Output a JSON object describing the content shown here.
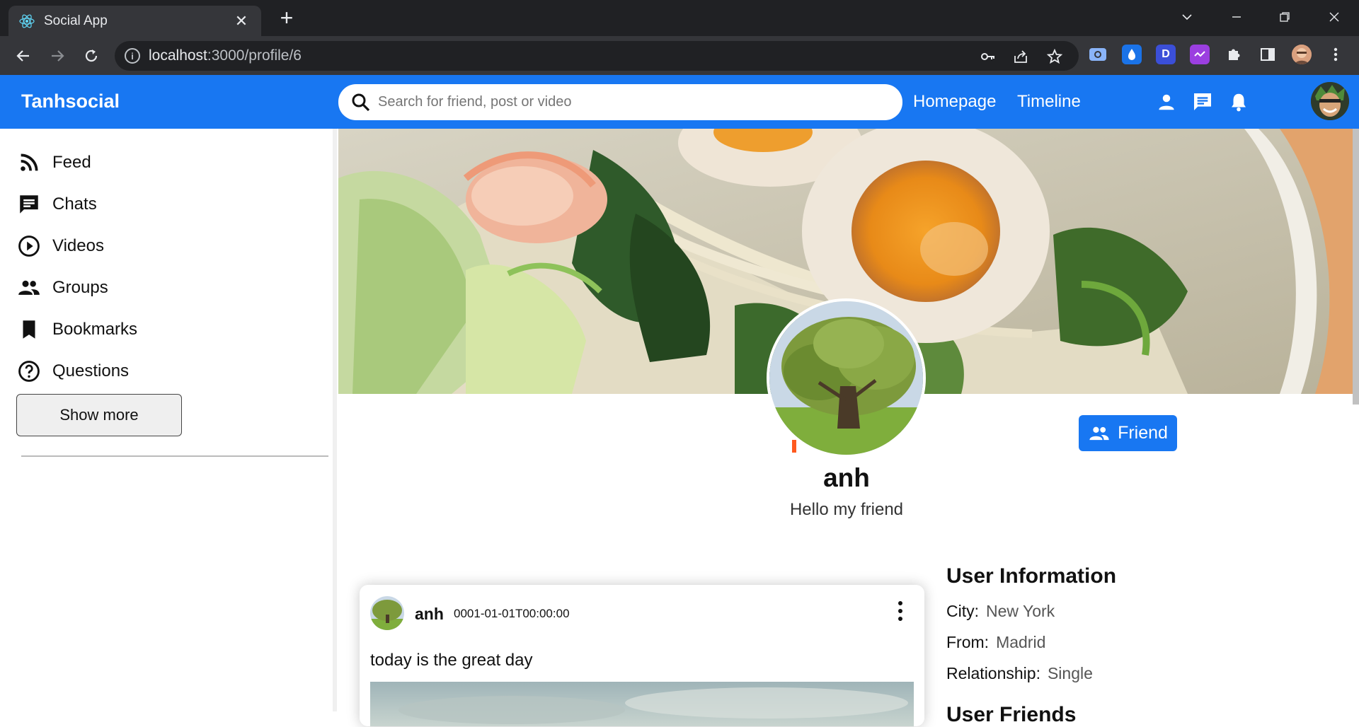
{
  "browser": {
    "tab_title": "Social App",
    "url_host": "localhost",
    "url_path": ":3000/profile/6"
  },
  "app": {
    "logo": "Tanhsocial",
    "search_placeholder": "Search for friend, post or video",
    "nav": {
      "homepage": "Homepage",
      "timeline": "Timeline"
    },
    "accent_color": "#1877f2"
  },
  "sidebar": {
    "items": [
      {
        "label": "Feed",
        "icon": "rss-feed-icon"
      },
      {
        "label": "Chats",
        "icon": "chat-icon"
      },
      {
        "label": "Videos",
        "icon": "play-circle-icon"
      },
      {
        "label": "Groups",
        "icon": "group-icon"
      },
      {
        "label": "Bookmarks",
        "icon": "bookmark-icon"
      },
      {
        "label": "Questions",
        "icon": "help-circle-icon"
      }
    ],
    "show_more": "Show more"
  },
  "profile": {
    "name": "anh",
    "description": "Hello my friend",
    "friend_button": "Friend"
  },
  "post": {
    "username": "anh",
    "date": "0001-01-01T00:00:00",
    "text": "today is the great day"
  },
  "user_info": {
    "title": "User Information",
    "city_label": "City:",
    "city": "New York",
    "from_label": "From:",
    "from": "Madrid",
    "relationship_label": "Relationship:",
    "relationship": "Single",
    "friends_title": "User Friends"
  }
}
